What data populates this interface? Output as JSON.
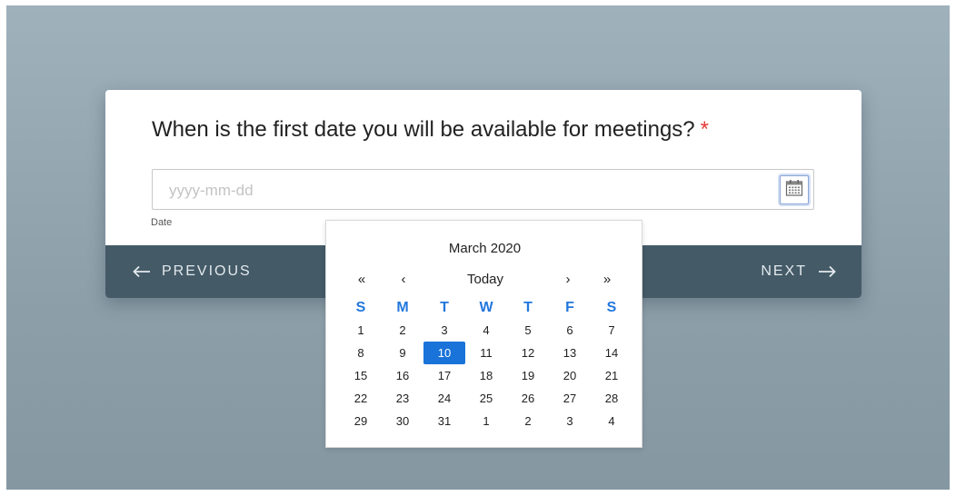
{
  "form": {
    "question": "When is the first date you will be available for meetings?",
    "required_mark": "*",
    "date_placeholder": "yyyy-mm-dd",
    "date_value": "",
    "sublabel": "Date",
    "calendar_icon": "calendar-icon"
  },
  "footer": {
    "previous_label": "PREVIOUS",
    "next_label": "NEXT"
  },
  "datepicker": {
    "month_label": "March 2020",
    "nav": {
      "prev_year": "«",
      "prev_month": "‹",
      "today": "Today",
      "next_month": "›",
      "next_year": "»"
    },
    "weekdays": [
      "S",
      "M",
      "T",
      "W",
      "T",
      "F",
      "S"
    ],
    "weeks": [
      [
        "1",
        "2",
        "3",
        "4",
        "5",
        "6",
        "7"
      ],
      [
        "8",
        "9",
        "10",
        "11",
        "12",
        "13",
        "14"
      ],
      [
        "15",
        "16",
        "17",
        "18",
        "19",
        "20",
        "21"
      ],
      [
        "22",
        "23",
        "24",
        "25",
        "26",
        "27",
        "28"
      ],
      [
        "29",
        "30",
        "31",
        "1",
        "2",
        "3",
        "4"
      ]
    ],
    "selected_day": "10",
    "accent_color": "#1a73d9"
  },
  "colors": {
    "footer_bg": "#445a67",
    "required": "#e53935",
    "weekday": "#2277dd"
  }
}
